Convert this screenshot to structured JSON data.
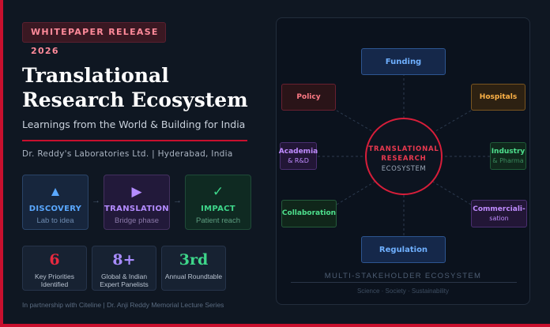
{
  "badge": "WHITEPAPER RELEASE 2026",
  "title": "Translational Research Ecosystem",
  "subtitle": "Learnings from the World & Building for India",
  "author": "Dr. Reddy's Laboratories Ltd. | Hyderabad, India",
  "phases": [
    {
      "icon": "triangle-up-icon",
      "glyph": "▲",
      "name": "DISCOVERY",
      "desc": "Lab to idea",
      "color": "#5aa8ff"
    },
    {
      "icon": "play-icon",
      "glyph": "▶",
      "name": "TRANSLATION",
      "desc": "Bridge phase",
      "color": "#b48cff"
    },
    {
      "icon": "check-icon",
      "glyph": "✓",
      "name": "IMPACT",
      "desc": "Patient reach",
      "color": "#3ed68a"
    }
  ],
  "arrows": [
    "→",
    "→"
  ],
  "stats": [
    {
      "value": "6",
      "label": "Key Priorities Identified"
    },
    {
      "value": "8+",
      "label": "Global & Indian Expert Panelists"
    },
    {
      "value": "3rd",
      "label": "Annual Roundtable"
    }
  ],
  "footer": "In partnership with Citeline | Dr. Anji Reddy Memorial Lecture Series",
  "ecosystem": {
    "center_line1": "TRANSLATIONAL",
    "center_line2": "RESEARCH",
    "center_line3": "ECOSYSTEM",
    "nodes": {
      "funding": "Funding",
      "policy": "Policy",
      "hospitals": "Hospitals",
      "academia": "Academia",
      "academia_sub": "& R&D",
      "industry": "Industry",
      "industry_sub": "& Pharma",
      "collaboration": "Collaboration",
      "commercialisation_1": "Commerciali-",
      "commercialisation_2": "sation",
      "regulation": "Regulation"
    },
    "caption": "MULTI-STAKEHOLDER ECOSYSTEM",
    "tagline": "Science · Society · Sustainability"
  },
  "colors": {
    "accent_red": "#c8102e",
    "discovery": "#5aa8ff",
    "translation": "#b48cff",
    "impact": "#3ed68a",
    "hospitals": "#ffb347",
    "funding": "#6fb0ff"
  }
}
